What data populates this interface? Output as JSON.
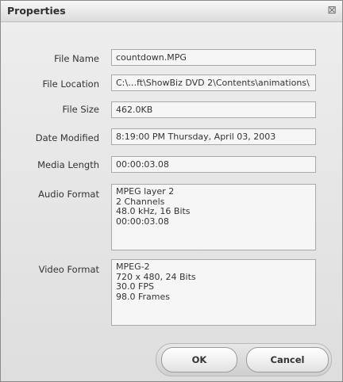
{
  "window": {
    "title": "Properties",
    "close_glyph": "⊠"
  },
  "properties": {
    "file_name": {
      "label": "File Name",
      "value": "countdown.MPG"
    },
    "file_location": {
      "label": "File Location",
      "value": "C:\\…ft\\ShowBiz DVD 2\\Contents\\animations\\"
    },
    "file_size": {
      "label": "File Size",
      "value": "462.0KB"
    },
    "date_modified": {
      "label": "Date Modified",
      "value": "8:19:00 PM Thursday, April 03, 2003"
    },
    "media_length": {
      "label": "Media Length",
      "value": "00:00:03.08"
    },
    "audio_format": {
      "label": "Audio Format",
      "lines": [
        "MPEG layer 2",
        "2 Channels",
        "48.0 kHz, 16 Bits",
        "00:00:03.08"
      ]
    },
    "video_format": {
      "label": "Video Format",
      "lines": [
        "MPEG-2",
        "720 x 480, 24 Bits",
        "30.0 FPS",
        "98.0 Frames"
      ]
    }
  },
  "buttons": {
    "ok": "OK",
    "cancel": "Cancel"
  }
}
